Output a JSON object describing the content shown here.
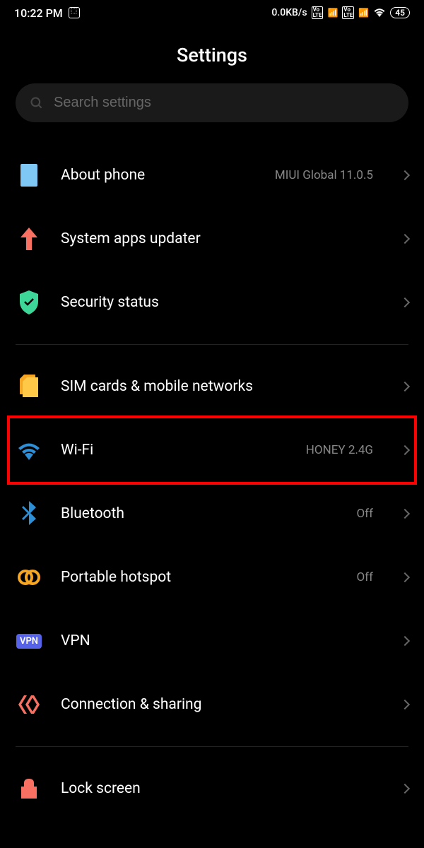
{
  "statusBar": {
    "time": "10:22 PM",
    "dataSpeed": "0.0KB/s",
    "battery": "45"
  },
  "title": "Settings",
  "search": {
    "placeholder": "Search settings"
  },
  "items": {
    "aboutPhone": {
      "label": "About phone",
      "value": "MIUI Global 11.0.5"
    },
    "systemApps": {
      "label": "System apps updater"
    },
    "security": {
      "label": "Security status"
    },
    "sim": {
      "label": "SIM cards & mobile networks"
    },
    "wifi": {
      "label": "Wi-Fi",
      "value": "HONEY 2.4G"
    },
    "bluetooth": {
      "label": "Bluetooth",
      "value": "Off"
    },
    "hotspot": {
      "label": "Portable hotspot",
      "value": "Off"
    },
    "vpn": {
      "label": "VPN",
      "badge": "VPN"
    },
    "connection": {
      "label": "Connection & sharing"
    },
    "lockscreen": {
      "label": "Lock screen"
    }
  }
}
